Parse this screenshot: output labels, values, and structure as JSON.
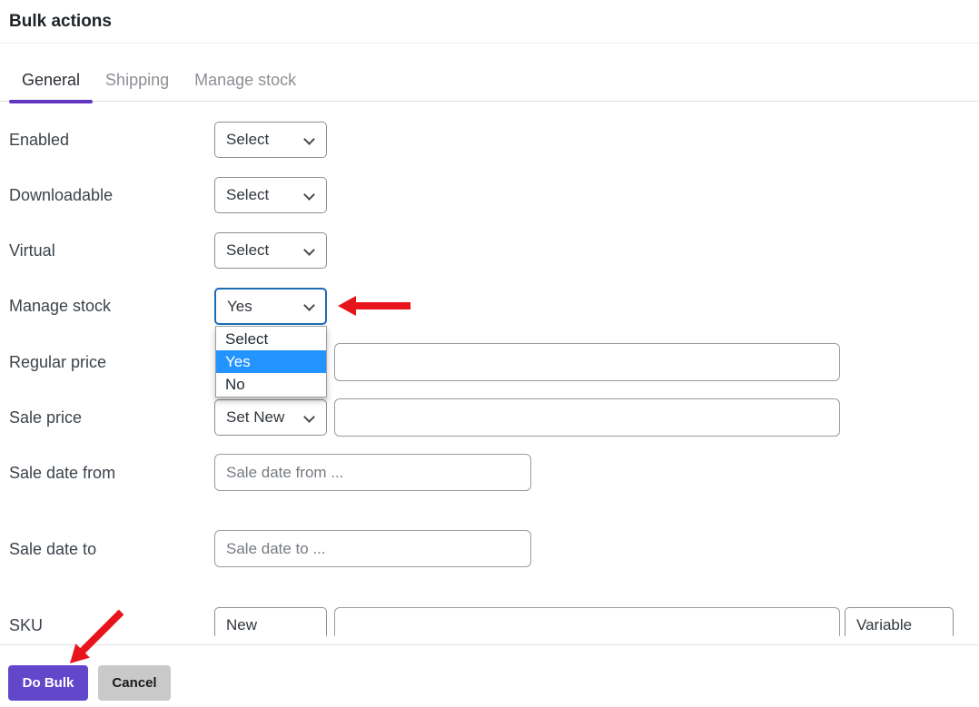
{
  "header": {
    "title": "Bulk actions"
  },
  "tabs": {
    "general": {
      "label": "General",
      "active": true
    },
    "shipping": {
      "label": "Shipping",
      "active": false
    },
    "manage_stock": {
      "label": "Manage stock",
      "active": false
    }
  },
  "form": {
    "enabled": {
      "label": "Enabled",
      "select_value": "Select"
    },
    "downloadable": {
      "label": "Downloadable",
      "select_value": "Select"
    },
    "virtual": {
      "label": "Virtual",
      "select_value": "Select"
    },
    "manage_stock": {
      "label": "Manage stock",
      "select_value": "Yes",
      "focused": true,
      "dropdown": {
        "options": [
          "Select",
          "Yes",
          "No"
        ],
        "selected": "Yes"
      }
    },
    "regular_price": {
      "label": "Regular price",
      "input_value": ""
    },
    "sale_price": {
      "label": "Sale price",
      "select_value": "Set New",
      "input_value": ""
    },
    "sale_date_from": {
      "label": "Sale date from",
      "placeholder": "Sale date from ..."
    },
    "sale_date_to": {
      "label": "Sale date to",
      "placeholder": "Sale date to ..."
    },
    "sku": {
      "label": "SKU",
      "select_value": "New",
      "input_value": "",
      "right_value": "Variable"
    }
  },
  "footer": {
    "do_bulk_label": "Do Bulk",
    "cancel_label": "Cancel"
  },
  "colors": {
    "accent_purple": "#6247cb",
    "tab_underline_purple": "#6236c2",
    "focus_blue": "#1c6cb5",
    "option_highlight_blue": "#2394ff",
    "annotation_arrow_red": "#e8141c"
  }
}
